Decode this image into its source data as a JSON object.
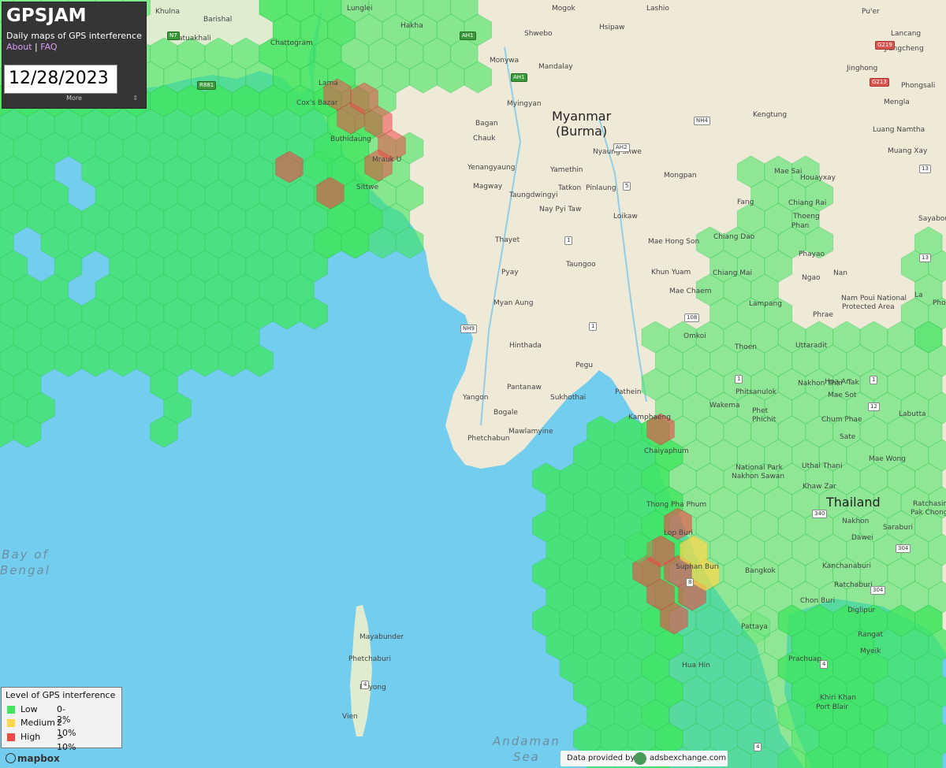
{
  "header": {
    "title": "GPSJAM",
    "subtitle": "Daily maps of GPS interference",
    "about_link": "About",
    "separator": "|",
    "faq_link": "FAQ",
    "date": "12/28/2023",
    "more_label": "More",
    "more_icon": "⇕"
  },
  "legend": {
    "title": "Level of GPS interference",
    "levels": [
      {
        "name": "Low",
        "range": "0-2%",
        "color": "#3fe65e"
      },
      {
        "name": "Medium",
        "range": "2-10%",
        "color": "#ffd84a"
      },
      {
        "name": "High",
        "range": "> 10%",
        "color": "#f04848"
      }
    ]
  },
  "map": {
    "colors": {
      "sea": "#72cdee",
      "land": "#f0ece0",
      "low": "#3fe65e",
      "medium": "#ffd84a",
      "high": "#f04848"
    },
    "countries": [
      "Myanmar",
      "(Burma)",
      "Thailand"
    ],
    "seas": [
      "Bay of",
      "Bengal",
      "Andaman",
      "Sea"
    ],
    "places": [
      "Lunglei",
      "Mogok",
      "Lashio",
      "Pu'er",
      "Khulna",
      "Barishal",
      "Patuakhali",
      "Chattogram",
      "Hakha",
      "Shwebo",
      "Hsipaw",
      "Lancang",
      "Jiangcheng",
      "Monywa",
      "Mandalay",
      "Jinghong",
      "Phongsali",
      "Lama",
      "Cox's Bazar",
      "Myingyan",
      "Mengla",
      "Bagan",
      "Kengtung",
      "Luang Namtha",
      "Buthidaung",
      "Chauk",
      "Nyaung Shwe",
      "Muang Xay",
      "Mrauk U",
      "Yenangyaung",
      "Yamethin",
      "Mongpan",
      "Mae Sai",
      "Houayxay",
      "Sittwe",
      "Magway",
      "Taungdwingyi",
      "Tatkon",
      "Pinlaung",
      "Fang",
      "Chiang Rai",
      "Nay Pyi Taw",
      "Loikaw",
      "Thoeng",
      "Phan",
      "Sayaboury",
      "Thayet",
      "Mae Hong Son",
      "Chiang Dao",
      "Phayao",
      "Taungoo",
      "Pyay",
      "Khun Yuam",
      "Chiang Mai",
      "Ngao",
      "Nan",
      "Mae Chaem",
      "Lampang",
      "Nam Poui National",
      "Protected Area",
      "Phrae",
      "Myan Aung",
      "Omkoi",
      "Hinthada",
      "Thoen",
      "Uttaradit",
      "Pegu",
      "Pantanaw",
      "Hpa-An",
      "Pathein",
      "Yangon",
      "Sukhothai",
      "Nakhon Thai",
      "Tak",
      "Phitsanulok",
      "Mae Sot",
      "Wakema",
      "Bogale",
      "Mawlamyine",
      "Kamphaeng",
      "Phet",
      "Phichit",
      "Chum Phae",
      "Labutta",
      "Phetchabun",
      "Sate",
      "Chaiyaphum",
      "Mae Wong",
      "National Park",
      "Nakhon Sawan",
      "Uthai Thani",
      "Khaw Zar",
      "Thong Pha Phum",
      "Lop Buri",
      "Nakhon",
      "Ratchasima",
      "Pak Chong",
      "Saraburi",
      "Dawei",
      "Suphan Buri",
      "Kanchanaburi",
      "Bangkok",
      "Ratchaburi",
      "Chon Buri",
      "Diglipur",
      "Mayabunder",
      "Phetchaburi",
      "Pattaya",
      "Rangat",
      "Rayong",
      "Myeik",
      "Hua Hin",
      "Prachuap",
      "Khiri Khan",
      "Port Blair",
      "Vien",
      "Phonho",
      "La"
    ],
    "roads": [
      "AH1",
      "AH1",
      "AH2",
      "NH4",
      "G219",
      "G213",
      "R881",
      "N7",
      "AH2",
      "5",
      "1",
      "1",
      "1",
      "NH9",
      "108",
      "1",
      "12",
      "12",
      "340",
      "304",
      "304",
      "8",
      "4",
      "4",
      "13",
      "13",
      "4"
    ]
  },
  "attribution": {
    "mapbox": "mapbox",
    "provider_prefix": "Data provided by",
    "provider": "adsbexchange.com"
  }
}
